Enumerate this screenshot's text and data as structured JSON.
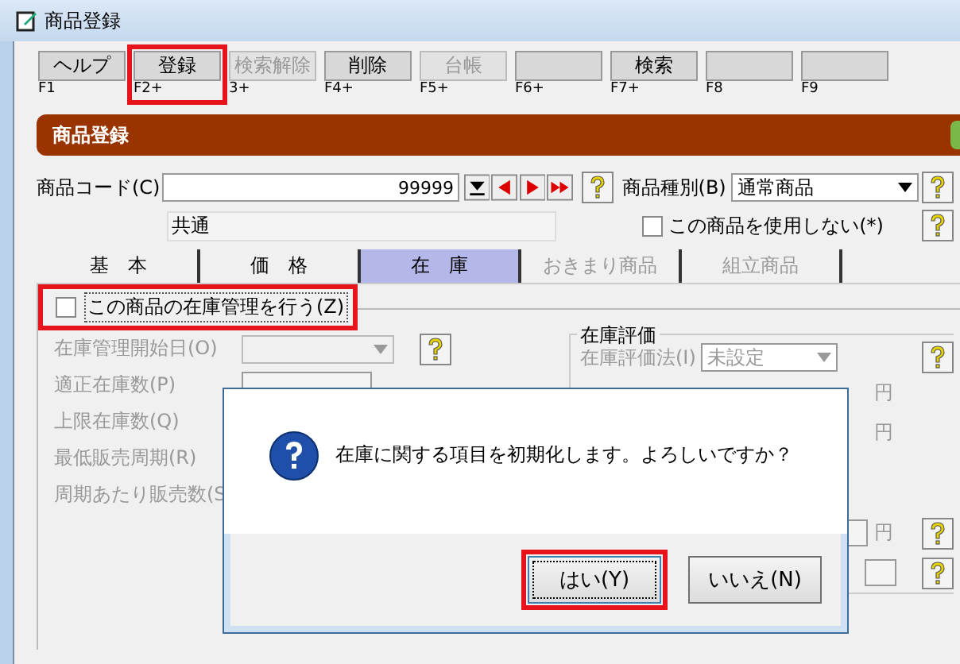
{
  "window": {
    "title": "商品登録"
  },
  "toolbar": [
    {
      "label": "ヘルプ",
      "key": "F1",
      "disabled": false,
      "highlighted": false
    },
    {
      "label": "登録",
      "key": "F2+",
      "disabled": false,
      "highlighted": true
    },
    {
      "label": "検索解除",
      "key": "3+",
      "disabled": true,
      "highlighted": false
    },
    {
      "label": "削除",
      "key": "F4+",
      "disabled": false,
      "highlighted": false
    },
    {
      "label": "台帳",
      "key": "F5+",
      "disabled": true,
      "highlighted": false
    },
    {
      "key": "F6+",
      "disabled": false,
      "highlighted": false
    },
    {
      "label": "検索",
      "key": "F7+",
      "disabled": false,
      "highlighted": false
    },
    {
      "key": "F8",
      "disabled": false,
      "highlighted": false
    },
    {
      "key": "F9",
      "disabled": false,
      "highlighted": false
    }
  ],
  "header": {
    "title": "商品登録"
  },
  "product_code": {
    "label": "商品コード(C)",
    "value": "99999"
  },
  "product_type": {
    "label": "商品種別(B)",
    "value": "通常商品"
  },
  "product_name": {
    "value": "共通"
  },
  "unused": {
    "label": "この商品を使用しない(*)",
    "checked": false
  },
  "tabs": [
    {
      "label": "基　本",
      "selected": false,
      "disabled": false
    },
    {
      "label": "価　格",
      "selected": false,
      "disabled": false
    },
    {
      "label": "在　庫",
      "selected": true,
      "disabled": false
    },
    {
      "label": "おきまり商品",
      "selected": false,
      "disabled": true
    },
    {
      "label": "組立商品",
      "selected": false,
      "disabled": true
    }
  ],
  "stock_toggle": {
    "label": "この商品の在庫管理を行う(Z)",
    "checked": false,
    "highlighted": true
  },
  "stock_fields": [
    {
      "label": "在庫管理開始日(O)",
      "kind": "combo"
    },
    {
      "label": "適正在庫数(P)",
      "kind": "field"
    },
    {
      "label": "上限在庫数(Q)",
      "kind": "none"
    },
    {
      "label": "最低販売周期(R)",
      "kind": "none"
    },
    {
      "label": "周期あたり販売数(S",
      "kind": "none"
    }
  ],
  "valuation": {
    "title": "在庫評価",
    "label": "在庫評価法(I)",
    "value": "未設定",
    "units": [
      "円",
      "円",
      "円"
    ]
  },
  "dialog": {
    "message": "在庫に関する項目を初期化します。よろしいですか？",
    "buttons": [
      {
        "label": "はい(Y)",
        "default": true,
        "highlighted": true
      },
      {
        "label": "いいえ(N)",
        "default": false,
        "highlighted": false
      }
    ]
  }
}
